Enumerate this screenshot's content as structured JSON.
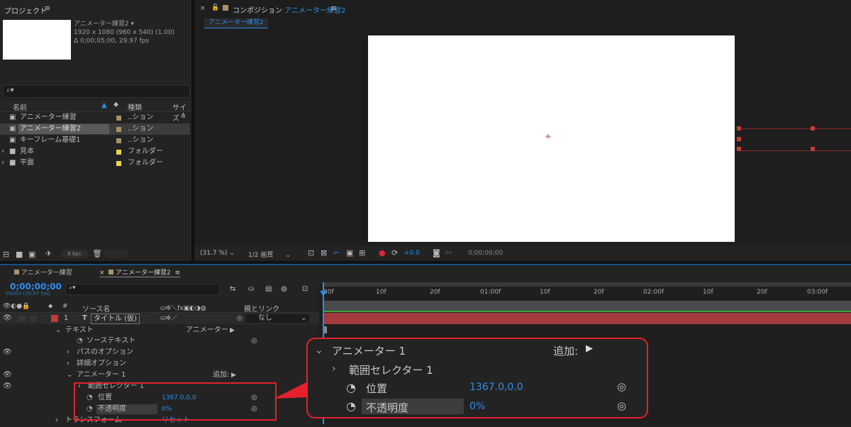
{
  "project": {
    "panel_title": "プロジェクト",
    "selected_name": "アニメーター練習2",
    "selected_info1": "1920 x 1080  (960 x 540) (1.00)",
    "selected_info2": "Δ 0;00;05;00, 29.97 fps",
    "search_placeholder": "",
    "col_name": "名前",
    "col_type": "種類",
    "col_size": "サイズ",
    "items": [
      {
        "name": "アニメーター練習",
        "type": "..ション",
        "color": "#a6936a"
      },
      {
        "name": "アニメーター練習2",
        "type": "..ション",
        "color": "#a6936a"
      },
      {
        "name": "キーフレーム基礎1",
        "type": "..ション",
        "color": "#a6936a"
      },
      {
        "name": "見本",
        "type": "フォルダー",
        "color": "#e8d94a"
      },
      {
        "name": "平面",
        "type": "フォルダー",
        "color": "#e8d94a"
      }
    ],
    "bpc": "8 bpc"
  },
  "composition": {
    "tab_prefix": "コンポジション",
    "tab_name": "アニメーター練習2",
    "subtab": "アニメーター練習2",
    "zoom": "(31.7 %)",
    "quality": "1/2 画質",
    "exposure": "+0.0",
    "timecode": "0;00;00;00"
  },
  "timeline": {
    "tab1": "アニメーター練習",
    "tab2": "アニメーター練習2",
    "timecode": "0;00;00;00",
    "timecode_sub": "00000 (29.97 fps)",
    "col_source": "ソース名",
    "col_parent": "親とリンク",
    "layer_num": "1",
    "layer_name": "タイトル (仮)",
    "parent_value": "なし",
    "props": {
      "text": "テキスト",
      "animator_label": "アニメーター :",
      "source_text": "ソーステキスト",
      "path_options": "パスのオプション",
      "more_options": "詳細オプション",
      "animator1": "アニメーター 1",
      "add": "追加:",
      "range_selector": "範囲セレクター 1",
      "position": "位置",
      "position_value": "1367.0,0.0",
      "opacity": "不透明度",
      "opacity_value": "0%",
      "transform": "トランスフォーム",
      "reset": "リセット"
    },
    "ruler": [
      "00f",
      "10f",
      "20f",
      "01:00f",
      "10f",
      "20f",
      "02:00f",
      "10f",
      "20f",
      "03:00f"
    ]
  },
  "callout": {
    "animator": "アニメーター 1",
    "add": "追加:",
    "range_selector": "範囲セレクター 1",
    "position": "位置",
    "position_value": "1367.0,0.0",
    "opacity": "不透明度",
    "opacity_value": "0%"
  },
  "colors": {
    "accent": "#2d8ceb",
    "highlight": "#e4212b",
    "layer_bar": "#a23a3e"
  }
}
